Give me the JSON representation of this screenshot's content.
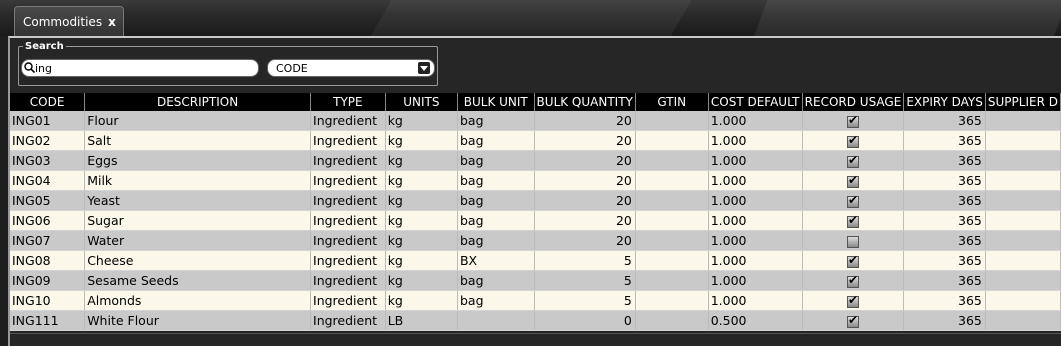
{
  "tab": {
    "label": "Commodities",
    "close": "x"
  },
  "search": {
    "legend": "Search",
    "value": "ing",
    "field": "CODE"
  },
  "columns": [
    "CODE",
    "DESCRIPTION",
    "TYPE",
    "UNITS",
    "BULK UNIT",
    "BULK QUANTITY",
    "GTIN",
    "COST DEFAULT",
    "RECORD USAGE",
    "EXPIRY DAYS",
    "SUPPLIER D"
  ],
  "rows": [
    {
      "code": "ING01",
      "description": "Flour",
      "type": "Ingredient",
      "units": "kg",
      "bulk_unit": "bag",
      "bulk_quantity": "20",
      "gtin": "",
      "cost_default": "1.000",
      "record_usage": true,
      "expiry_days": "365",
      "supplier": ""
    },
    {
      "code": "ING02",
      "description": "Salt",
      "type": "Ingredient",
      "units": "kg",
      "bulk_unit": "bag",
      "bulk_quantity": "20",
      "gtin": "",
      "cost_default": "1.000",
      "record_usage": true,
      "expiry_days": "365",
      "supplier": ""
    },
    {
      "code": "ING03",
      "description": "Eggs",
      "type": "Ingredient",
      "units": "kg",
      "bulk_unit": "bag",
      "bulk_quantity": "20",
      "gtin": "",
      "cost_default": "1.000",
      "record_usage": true,
      "expiry_days": "365",
      "supplier": ""
    },
    {
      "code": "ING04",
      "description": "Milk",
      "type": "Ingredient",
      "units": "kg",
      "bulk_unit": "bag",
      "bulk_quantity": "20",
      "gtin": "",
      "cost_default": "1.000",
      "record_usage": true,
      "expiry_days": "365",
      "supplier": ""
    },
    {
      "code": "ING05",
      "description": "Yeast",
      "type": "Ingredient",
      "units": "kg",
      "bulk_unit": "bag",
      "bulk_quantity": "20",
      "gtin": "",
      "cost_default": "1.000",
      "record_usage": true,
      "expiry_days": "365",
      "supplier": ""
    },
    {
      "code": "ING06",
      "description": "Sugar",
      "type": "Ingredient",
      "units": "kg",
      "bulk_unit": "bag",
      "bulk_quantity": "20",
      "gtin": "",
      "cost_default": "1.000",
      "record_usage": true,
      "expiry_days": "365",
      "supplier": ""
    },
    {
      "code": "ING07",
      "description": "Water",
      "type": "Ingredient",
      "units": "kg",
      "bulk_unit": "bag",
      "bulk_quantity": "20",
      "gtin": "",
      "cost_default": "1.000",
      "record_usage": false,
      "expiry_days": "365",
      "supplier": ""
    },
    {
      "code": "ING08",
      "description": "Cheese",
      "type": "Ingredient",
      "units": "kg",
      "bulk_unit": "BX",
      "bulk_quantity": "5",
      "gtin": "",
      "cost_default": "1.000",
      "record_usage": true,
      "expiry_days": "365",
      "supplier": ""
    },
    {
      "code": "ING09",
      "description": "Sesame Seeds",
      "type": "Ingredient",
      "units": "kg",
      "bulk_unit": "bag",
      "bulk_quantity": "5",
      "gtin": "",
      "cost_default": "1.000",
      "record_usage": true,
      "expiry_days": "365",
      "supplier": ""
    },
    {
      "code": "ING10",
      "description": "Almonds",
      "type": "Ingredient",
      "units": "kg",
      "bulk_unit": "bag",
      "bulk_quantity": "5",
      "gtin": "",
      "cost_default": "1.000",
      "record_usage": true,
      "expiry_days": "365",
      "supplier": ""
    },
    {
      "code": "ING111",
      "description": "White Flour",
      "type": "Ingredient",
      "units": "LB",
      "bulk_unit": "",
      "bulk_quantity": "0",
      "gtin": "",
      "cost_default": "0.500",
      "record_usage": true,
      "expiry_days": "365",
      "supplier": ""
    }
  ]
}
